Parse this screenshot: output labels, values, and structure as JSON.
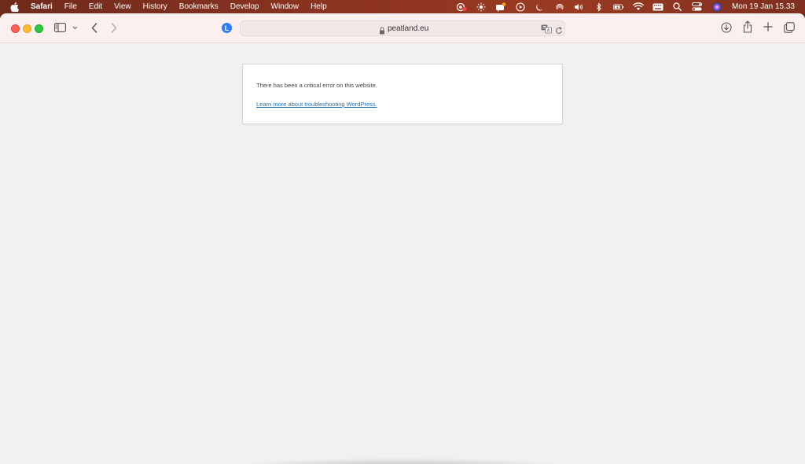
{
  "menubar": {
    "app_name": "Safari",
    "items": [
      {
        "label": "File"
      },
      {
        "label": "Edit"
      },
      {
        "label": "View"
      },
      {
        "label": "History"
      },
      {
        "label": "Bookmarks"
      },
      {
        "label": "Develop"
      },
      {
        "label": "Window"
      },
      {
        "label": "Help"
      }
    ],
    "clock": "Mon 19 Jan  15.33"
  },
  "toolbar": {
    "extension_badge": "L",
    "address": {
      "url": "peatland.eu"
    }
  },
  "page": {
    "error_message": "There has been a critical error on this website.",
    "help_link": "Learn more about troubleshooting WordPress."
  },
  "colors": {
    "link": "#2271b1",
    "close": "#fe5f57",
    "minimize": "#febc2e",
    "maximize": "#28c840",
    "badge": "#2f7cf6"
  }
}
